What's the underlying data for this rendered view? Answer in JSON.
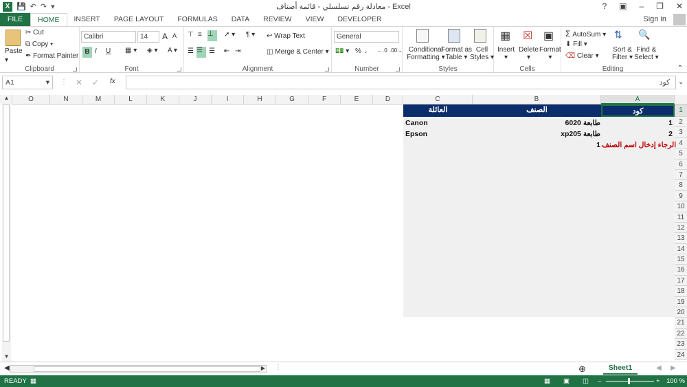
{
  "app": {
    "title": "معادلة رقم تسلسلي - قائمة أصناف - Excel",
    "logo": "X",
    "signin": "Sign in",
    "help": "?"
  },
  "tabs": [
    "FILE",
    "HOME",
    "INSERT",
    "PAGE LAYOUT",
    "FORMULAS",
    "DATA",
    "REVIEW",
    "VIEW",
    "DEVELOPER"
  ],
  "ribbon": {
    "clipboard": {
      "label": "Clipboard",
      "paste": "Paste",
      "cut": "Cut",
      "copy": "Copy",
      "format_painter": "Format Painter"
    },
    "font": {
      "label": "Font",
      "name": "Calibri",
      "size": "14",
      "bold": "B",
      "italic": "I",
      "underline": "U",
      "grow": "A",
      "shrink": "A"
    },
    "alignment": {
      "label": "Alignment",
      "wrap": "Wrap Text",
      "merge": "Merge & Center"
    },
    "number": {
      "label": "Number",
      "format": "General",
      "percent": "%",
      "comma": "،"
    },
    "styles": {
      "label": "Styles",
      "conditional1": "Conditional",
      "conditional2": "Formatting",
      "table1": "Format as",
      "table2": "Table",
      "cell1": "Cell",
      "cell2": "Styles"
    },
    "cells": {
      "label": "Cells",
      "insert": "Insert",
      "delete": "Delete",
      "format": "Format"
    },
    "editing": {
      "label": "Editing",
      "autosum": "AutoSum",
      "fill": "Fill",
      "clear": "Clear",
      "sort1": "Sort &",
      "sort2": "Filter",
      "find1": "Find &",
      "find2": "Select"
    }
  },
  "formula_bar": {
    "name_box": "A1",
    "fx": "fx",
    "value": "كود"
  },
  "columns": [
    "O",
    "N",
    "M",
    "L",
    "K",
    "J",
    "I",
    "H",
    "G",
    "F",
    "E",
    "D",
    "C",
    "B",
    "A"
  ],
  "rows": [
    "1",
    "2",
    "3",
    "4",
    "5",
    "6",
    "7",
    "8",
    "9",
    "10",
    "11",
    "12",
    "13",
    "14",
    "15",
    "16",
    "17",
    "18",
    "19",
    "20",
    "21",
    "22",
    "23",
    "24"
  ],
  "header_cells": {
    "a": "كود",
    "b": "الصنف",
    "c": "العائلة"
  },
  "data_rows": [
    {
      "a": "1",
      "b_ar": "طابعة",
      "b_en": "6020",
      "c": "Canon"
    },
    {
      "a": "2",
      "b_ar": "طابعة",
      "b_en": "xp205",
      "c": "Epson"
    }
  ],
  "row4": {
    "a_msg": "الرجاء إدخال اسم الصنف",
    "b": "1"
  },
  "colors": {
    "brand": "#217346",
    "header_fill": "#0b2d6b",
    "error_text": "#c00000"
  },
  "sheet": {
    "tab": "Sheet1"
  },
  "status": {
    "ready": "READY",
    "zoom": "100 %"
  }
}
